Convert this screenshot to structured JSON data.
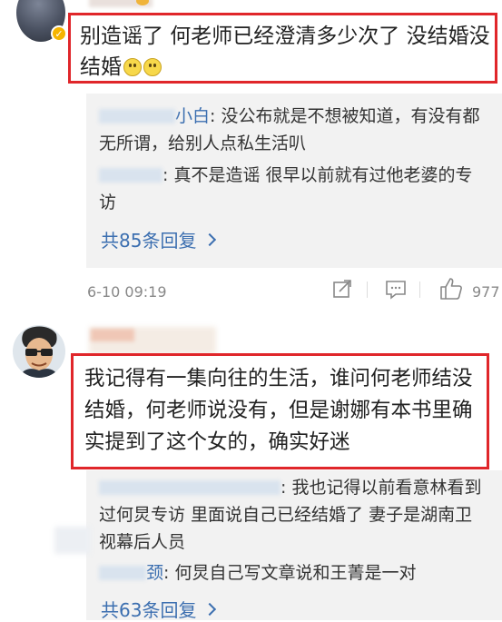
{
  "comment1": {
    "text": "别造谣了 何老师已经澄清多少次了 没结婚没结婚",
    "replies": [
      {
        "name_tail": "小白",
        "text": ": 没公布就是不想被知道，有没有都无所谓，给别人点私生活叭"
      },
      {
        "name_tail": "",
        "text": ": 真不是造谣 很早以前就有过他老婆的专访"
      }
    ],
    "more_replies": "共85条回复",
    "timestamp": "6-10 09:19",
    "like_count": "977"
  },
  "comment2": {
    "text": "我记得有一集向往的生活，谁问何老师结没结婚，何老师说没有，但是谢娜有本书里确实提到了这个女的，确实好迷",
    "replies": [
      {
        "name_tail": "",
        "text": ": 我也记得以前看意林看到过何炅专访 里面说自己已经结婚了 妻子是湖南卫视幕后人员"
      },
      {
        "name_tail": "颈",
        "text": ": 何炅自己写文章说和王菁是一对"
      }
    ],
    "more_replies": "共63条回复"
  },
  "icons": [
    "smile-emoji-icon",
    "verified-badge-icon",
    "share-icon",
    "comment-icon",
    "like-icon",
    "chevron-right-icon"
  ],
  "colors": {
    "highlight_border": "#e0262a",
    "link": "#3c6fb0",
    "panel_bg": "#f2f2f2",
    "meta": "#888888"
  }
}
